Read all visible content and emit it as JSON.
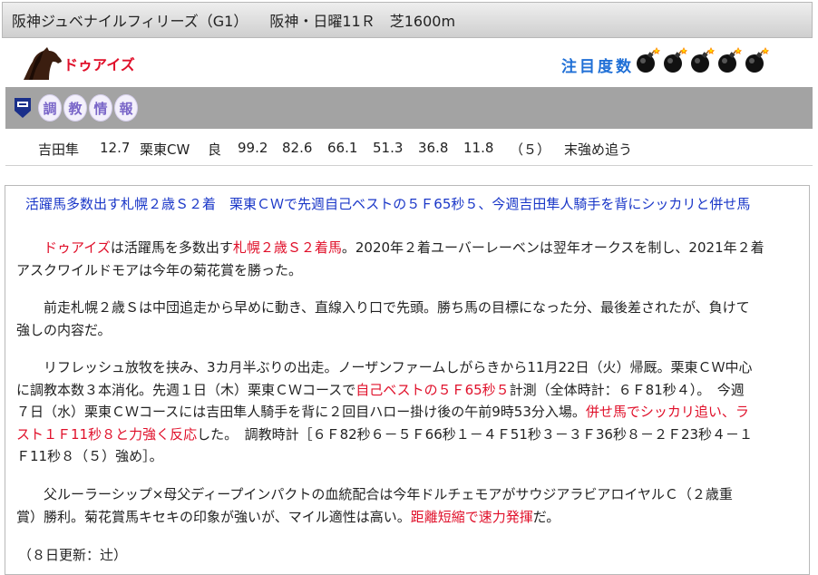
{
  "race_header": {
    "race_name": "阪神ジュベナイルフィリーズ（G1）",
    "venue": "阪神・日曜11Ｒ",
    "distance": "芝1600m"
  },
  "horse": {
    "name": "ドゥアイズ",
    "attention_label": "注目度数",
    "attention_count": 5,
    "bomb_icon": "bomb-icon"
  },
  "training_section": {
    "label_chars": [
      "調",
      "教",
      "情",
      "報"
    ],
    "record": {
      "rider": "吉田隼",
      "weight": "12.7",
      "course": "栗東CW",
      "track_condition": "良",
      "times": [
        "99.2",
        "82.6",
        "66.1",
        "51.3",
        "36.8",
        "11.8"
      ],
      "position": "（５）",
      "intensity": "末強め追う"
    }
  },
  "article": {
    "headline": "活躍馬多数出す札幌２歳Ｓ２着　栗東ＣＷで先週自己ベストの５Ｆ65秒５、今週吉田隼人騎手を背にシッカリと併せ馬",
    "p1": {
      "name": "ドゥアイズ",
      "t1": "は活躍馬を多数出す",
      "red1": "札幌２歳Ｓ２着馬",
      "t2": "。2020年２着ユーバーレーベンは翌年オークスを制し、2021年２着",
      "line2": "アスクワイルドモアは今年の菊花賞を勝った。"
    },
    "p2": {
      "line1": "前走札幌２歳Ｓは中団追走から早めに動き、直線入り口で先頭。勝ち馬の目標になった分、最後差されたが、負けて",
      "line2": "強しの内容だ。"
    },
    "p3": {
      "line1": "リフレッシュ放牧を挟み、3カ月半ぶりの出走。ノーザンファームしがらきから11月22日（火）帰厩。栗東ＣＷ中心",
      "line2a": "に調教本数３本消化。先週１日（木）栗東ＣＷコースで",
      "line2red": "自己ベストの５Ｆ65秒５",
      "line2b": "計測（全体時計：６Ｆ81秒４）。　今週",
      "line3a": "７日（水）栗東ＣＷコースには吉田隼人騎手を背に２回目ハロー掛け後の午前9時53分入場。",
      "line3red": "併せ馬でシッカリ追い、ラ",
      "line4red": "スト１Ｆ11秒８と力強く反応",
      "line4b": "した。　調教時計［６Ｆ82秒６－５Ｆ66秒１－４Ｆ51秒３－３Ｆ36秒８－２Ｆ23秒４－１",
      "line5": "Ｆ11秒８（５）強め］。"
    },
    "p4": {
      "line1": "父ルーラーシップ×母父ディープインパクトの血統配合は今年ドルチェモアがサウジアラビアロイヤルＣ（２歳重",
      "line2a": "賞）勝利。菊花賞馬キセキの印象が強いが、マイル適性は高い。",
      "line2red": "距離短縮で速力発揮",
      "line2b": "だ。"
    },
    "update_note": "（８日更新：辻）"
  },
  "colors": {
    "accent_red": "#e0102a",
    "headline_blue": "#1a37c8",
    "attention_blue": "#1f6fd6",
    "section_gray": "#a3a3a3"
  }
}
